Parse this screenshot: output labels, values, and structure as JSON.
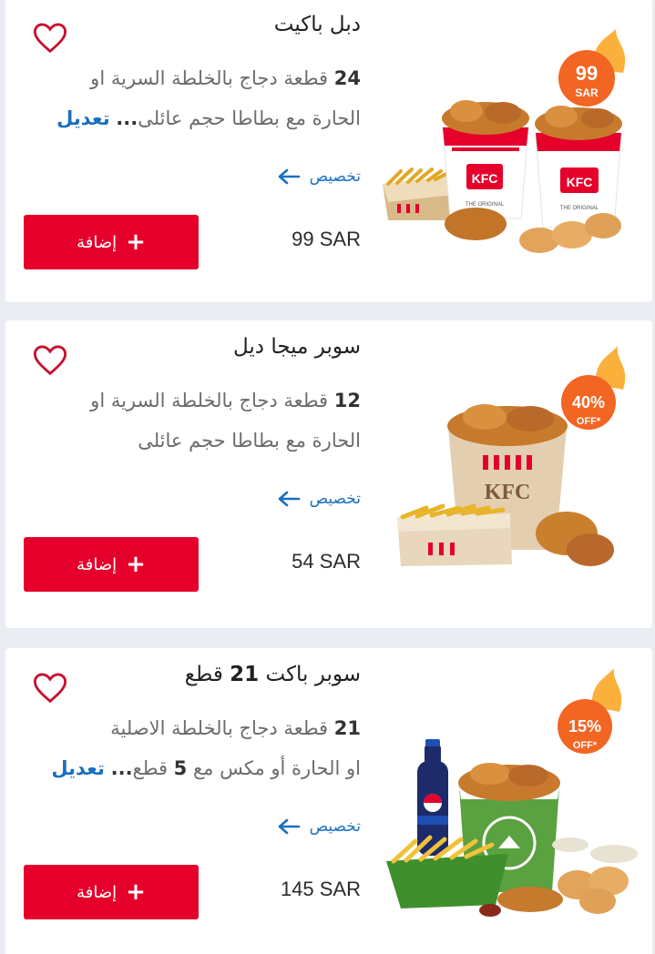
{
  "colors": {
    "accent": "#e4002b",
    "link": "#1a6fbf",
    "badge": "#f26522",
    "flame": "#fbb03b"
  },
  "products": [
    {
      "title": "دبل باكيت",
      "title_bold": "",
      "title_suffix": "",
      "desc_num": "24",
      "desc_line1_rest": " قطعة دجاج بالخلطة السرية او",
      "desc_line2": "الحارة مع بطاطا حجم عائلى",
      "dots": "...",
      "edit_label": "تعديل",
      "customize_label": "تخصيص",
      "price": "99 SAR",
      "add_label": "إضافة",
      "badge_top": "99",
      "badge_bottom": "SAR",
      "favorite_icon": "heart-outline-icon"
    },
    {
      "title": "سوبر ميجا ديل",
      "title_bold": "",
      "title_suffix": "",
      "desc_num": "12",
      "desc_line1_rest": " قطعة دجاج بالخلطة السرية او",
      "desc_line2": "الحارة مع بطاطا حجم عائلى",
      "dots": "",
      "edit_label": "",
      "customize_label": "تخصيص",
      "price": "54 SAR",
      "add_label": "إضافة",
      "badge_top": "40%",
      "badge_bottom": "OFF*",
      "favorite_icon": "heart-outline-icon"
    },
    {
      "title": "سوبر باكت ",
      "title_bold": "21",
      "title_suffix": " قطع",
      "desc_num": "21",
      "desc_line1_rest": " قطعة دجاج بالخلطة الاصلية",
      "desc_line2_pre": "او الحارة أو مكس مع ",
      "desc_line2_num": "5",
      "desc_line2_post": " قطع",
      "dots": "...",
      "edit_label": "تعديل",
      "customize_label": "تخصيص",
      "price": "145 SAR",
      "add_label": "إضافة",
      "badge_top": "15%",
      "badge_bottom": "OFF*",
      "favorite_icon": "heart-outline-icon"
    }
  ]
}
